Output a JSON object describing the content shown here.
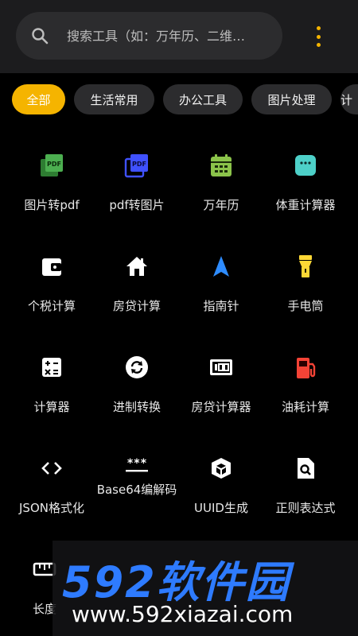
{
  "search": {
    "placeholder": "搜索工具（如：万年历、二维…"
  },
  "tabs": [
    {
      "label": "全部",
      "active": true
    },
    {
      "label": "生活常用",
      "active": false
    },
    {
      "label": "办公工具",
      "active": false
    },
    {
      "label": "图片处理",
      "active": false
    },
    {
      "label": "计",
      "active": false
    }
  ],
  "tools": [
    {
      "label": "图片转pdf",
      "icon": "image-to-pdf-icon",
      "color": "#4caf50"
    },
    {
      "label": "pdf转图片",
      "icon": "pdf-to-image-icon",
      "color": "#3f51ff"
    },
    {
      "label": "万年历",
      "icon": "calendar-icon",
      "color": "#8bc34a"
    },
    {
      "label": "体重计算器",
      "icon": "scale-icon",
      "color": "#4dd0c8"
    },
    {
      "label": "个税计算",
      "icon": "wallet-icon",
      "color": "#ffffff"
    },
    {
      "label": "房贷计算",
      "icon": "house-icon",
      "color": "#ffffff"
    },
    {
      "label": "指南针",
      "icon": "compass-icon",
      "color": "#2e8cff"
    },
    {
      "label": "手电筒",
      "icon": "flashlight-icon",
      "color": "#fdd835"
    },
    {
      "label": "计算器",
      "icon": "calculator-icon",
      "color": "#ffffff"
    },
    {
      "label": "进制转换",
      "icon": "convert-icon",
      "color": "#ffffff"
    },
    {
      "label": "房贷计算器",
      "icon": "counter-icon",
      "color": "#ffffff"
    },
    {
      "label": "油耗计算",
      "icon": "gas-station-icon",
      "color": "#f44336"
    },
    {
      "label": "JSON格式化",
      "icon": "code-icon",
      "color": "#ffffff"
    },
    {
      "label": "Base64编解码",
      "icon": "password-icon",
      "color": "#ffffff"
    },
    {
      "label": "UUID生成",
      "icon": "cube-icon",
      "color": "#ffffff"
    },
    {
      "label": "正则表达式",
      "icon": "file-search-icon",
      "color": "#ffffff"
    },
    {
      "label": "长度",
      "icon": "ruler-icon",
      "color": "#ffffff"
    }
  ],
  "watermark": {
    "title": "592软件园",
    "url": "www.592xiazai.com"
  },
  "colors": {
    "accent": "#f5b400",
    "background": "#000000",
    "chip": "#2c2c2e"
  }
}
